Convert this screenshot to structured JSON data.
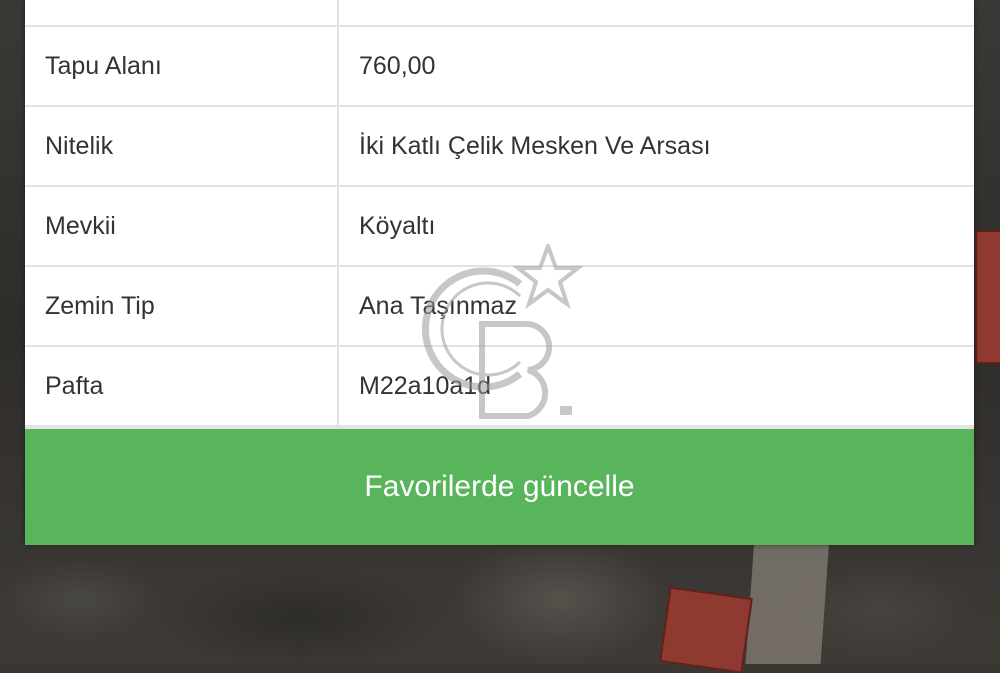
{
  "table": {
    "rows": [
      {
        "label": "Tapu Alanı",
        "value": "760,00"
      },
      {
        "label": "Nitelik",
        "value": "İki Katlı Çelik Mesken Ve Arsası"
      },
      {
        "label": "Mevkii",
        "value": "Köyaltı"
      },
      {
        "label": "Zemin Tip",
        "value": "Ana Taşınmaz"
      },
      {
        "label": "Pafta",
        "value": "M22a10a1d"
      }
    ]
  },
  "action": {
    "label": "Favorilerde güncelle",
    "color": "#58b55c"
  },
  "watermark": {
    "icon": "cb-logo-icon"
  }
}
